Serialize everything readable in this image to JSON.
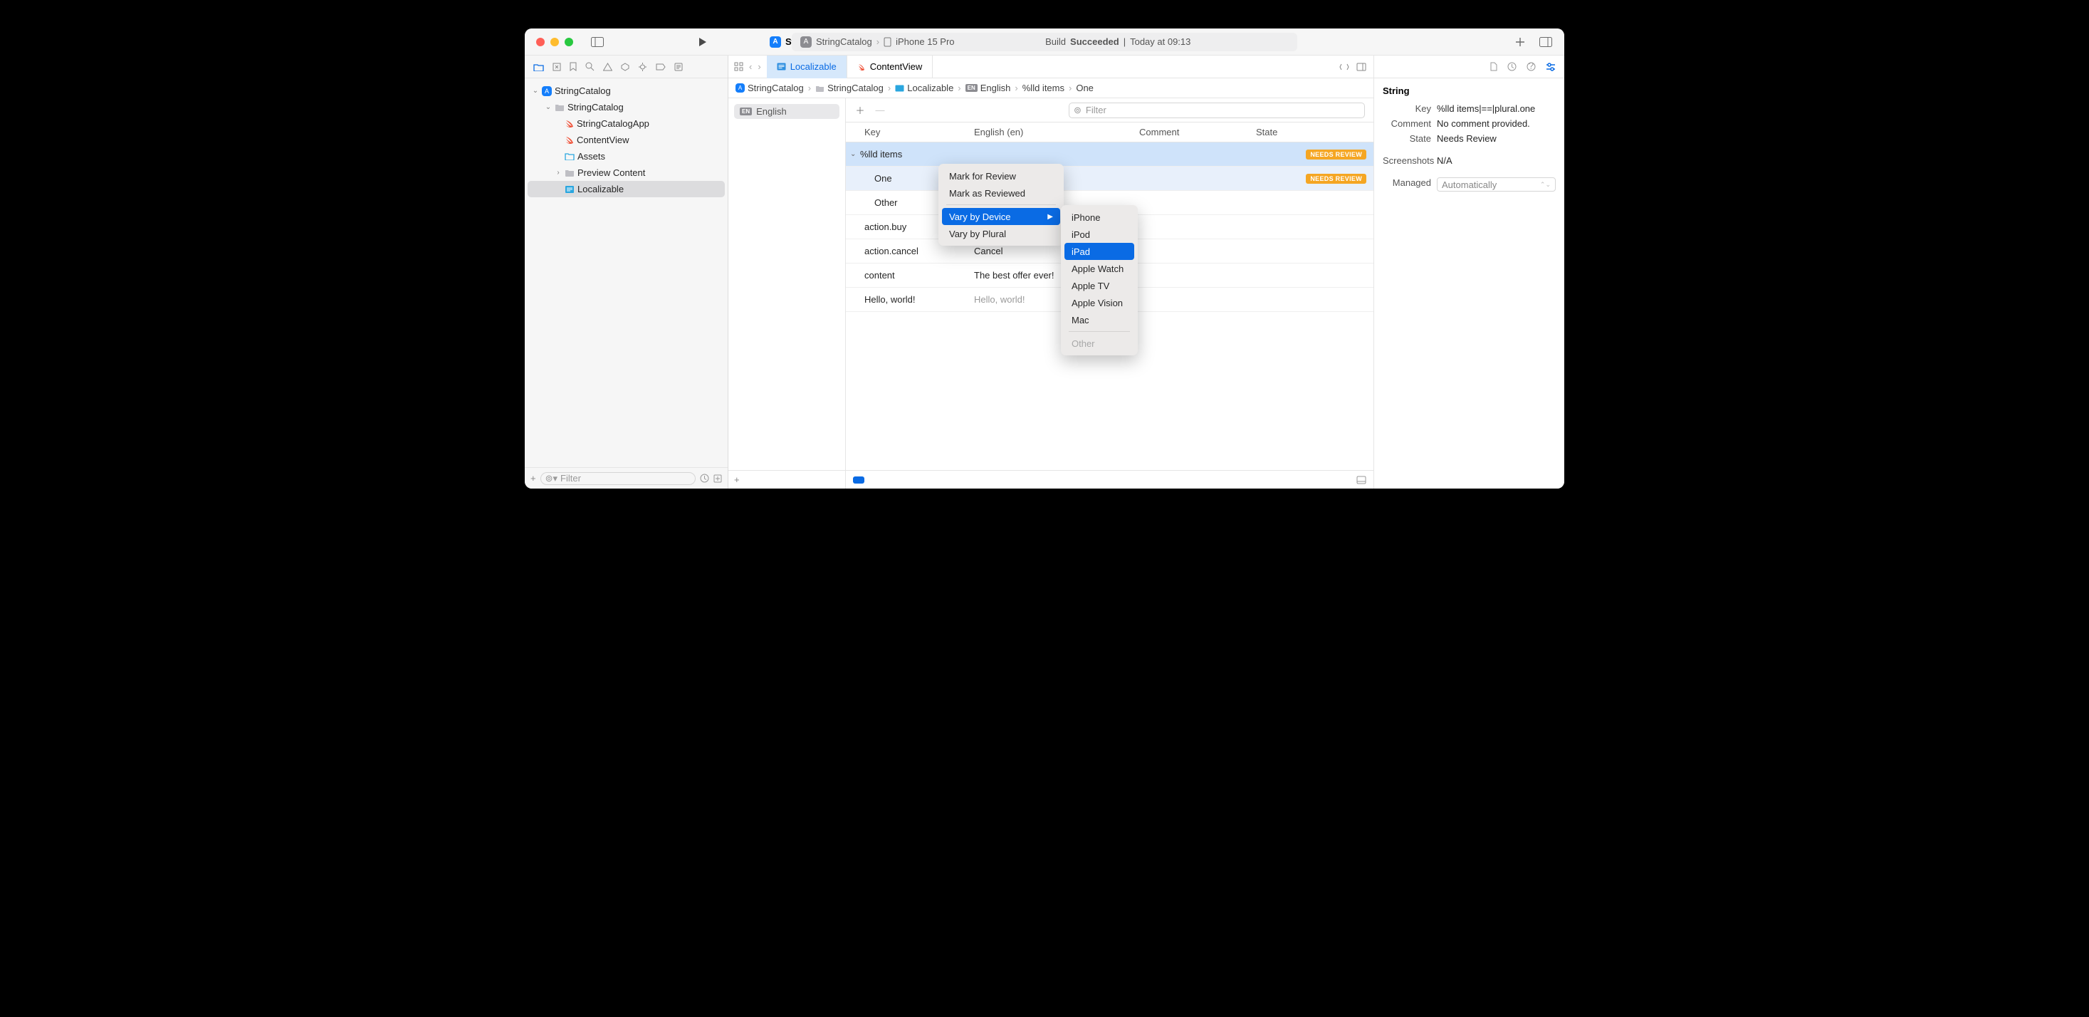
{
  "titlebar": {
    "project_name": "StringCatalog",
    "scheme": "StringCatalog",
    "destination": "iPhone 15 Pro",
    "status_prefix": "Build ",
    "status_bold": "Succeeded",
    "status_sep": " | ",
    "status_time": "Today at 09:13"
  },
  "navigator": {
    "tree": {
      "root": "StringCatalog",
      "group": "StringCatalog",
      "app": "StringCatalogApp",
      "contentview": "ContentView",
      "assets": "Assets",
      "preview": "Preview Content",
      "localizable": "Localizable"
    },
    "filter_placeholder": "Filter"
  },
  "tabs": {
    "localizable": "Localizable",
    "contentview": "ContentView"
  },
  "breadcrumb": {
    "a": "StringCatalog",
    "b": "StringCatalog",
    "c": "Localizable",
    "d": "English",
    "e": "%lld items",
    "f": "One"
  },
  "lang": {
    "badge": "EN",
    "name": "English"
  },
  "table": {
    "filter_placeholder": "Filter",
    "head": {
      "key": "Key",
      "eng": "English (en)",
      "com": "Comment",
      "state": "State"
    },
    "rows": {
      "group": {
        "key": "%lld items",
        "badge": "NEEDS REVIEW"
      },
      "one": {
        "key": "One",
        "badge": "NEEDS REVIEW"
      },
      "other": {
        "key": "Other"
      },
      "buy": {
        "key": "action.buy"
      },
      "cancel": {
        "key": "action.cancel",
        "eng": "Cancel"
      },
      "content": {
        "key": "content",
        "eng": "The best offer ever!"
      },
      "hello": {
        "key": "Hello, world!",
        "eng": "Hello, world!"
      }
    }
  },
  "context_menu": {
    "mark_review": "Mark for Review",
    "mark_reviewed": "Mark as Reviewed",
    "vary_device": "Vary by Device",
    "vary_plural": "Vary by Plural"
  },
  "device_menu": {
    "iphone": "iPhone",
    "ipod": "iPod",
    "ipad": "iPad",
    "watch": "Apple Watch",
    "tv": "Apple TV",
    "vision": "Apple Vision",
    "mac": "Mac",
    "other": "Other"
  },
  "inspector": {
    "heading": "String",
    "rows": {
      "key_label": "Key",
      "key_value": "%lld items|==|plural.one",
      "comment_label": "Comment",
      "comment_value": "No comment provided.",
      "state_label": "State",
      "state_value": "Needs Review",
      "screens_label": "Screenshots",
      "screens_value": "N/A",
      "managed_label": "Managed",
      "managed_value": "Automatically"
    }
  }
}
